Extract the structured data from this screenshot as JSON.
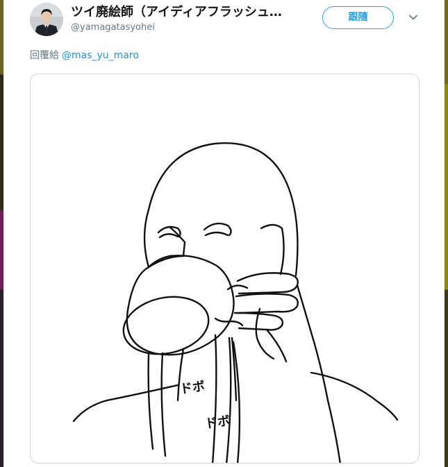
{
  "tweet": {
    "display_name": "ツイ廃絵師（アイディアフラッシュ…",
    "handle": "@yamagatasyohei",
    "follow_label": "跟隨",
    "reply_prefix": "回覆給",
    "reply_mention": "@mas_yu_maro",
    "more_icon": "chevron-down-icon",
    "avatar": "profile-photo-man-in-suit"
  },
  "media": {
    "description_icon": "line-drawing-person-pouring-from-mug",
    "sfx_1": "ドボ",
    "sfx_2": "ドボ"
  },
  "colors": {
    "accent": "#1da1f2",
    "mention": "#1b95e0",
    "text_primary": "#14171a",
    "text_secondary": "#657786",
    "border": "#ccd6dd"
  }
}
